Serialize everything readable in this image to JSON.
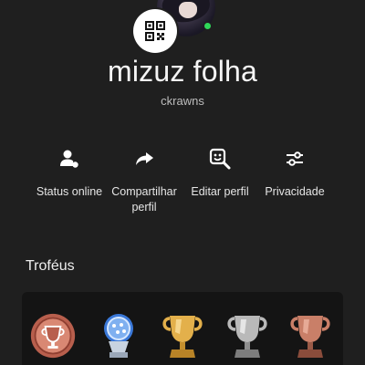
{
  "profile": {
    "name": "mizuz folha",
    "handle": "ckrawns",
    "online": true,
    "online_color": "#2fd75a"
  },
  "qr_button": {
    "icon": "qr-code-icon"
  },
  "actions": [
    {
      "id": "status-online",
      "label": "Status online",
      "icon": "user-status-icon"
    },
    {
      "id": "share-profile",
      "label": "Compartilhar perfil",
      "icon": "share-icon"
    },
    {
      "id": "edit-profile",
      "label": "Editar perfil",
      "icon": "edit-avatar-icon"
    },
    {
      "id": "privacy",
      "label": "Privacidade",
      "icon": "sliders-icon"
    }
  ],
  "trophies": {
    "title": "Troféus",
    "items": [
      {
        "kind": "level",
        "icon": "trophy-level-icon",
        "color": "#c9705e"
      },
      {
        "kind": "platinum",
        "icon": "platinum-trophy-icon",
        "color": "#8fb6e8"
      },
      {
        "kind": "gold",
        "icon": "gold-trophy-icon",
        "color": "#d9a441"
      },
      {
        "kind": "silver",
        "icon": "silver-trophy-icon",
        "color": "#b8b8b8"
      },
      {
        "kind": "bronze",
        "icon": "bronze-trophy-icon",
        "color": "#c9806a"
      }
    ]
  }
}
